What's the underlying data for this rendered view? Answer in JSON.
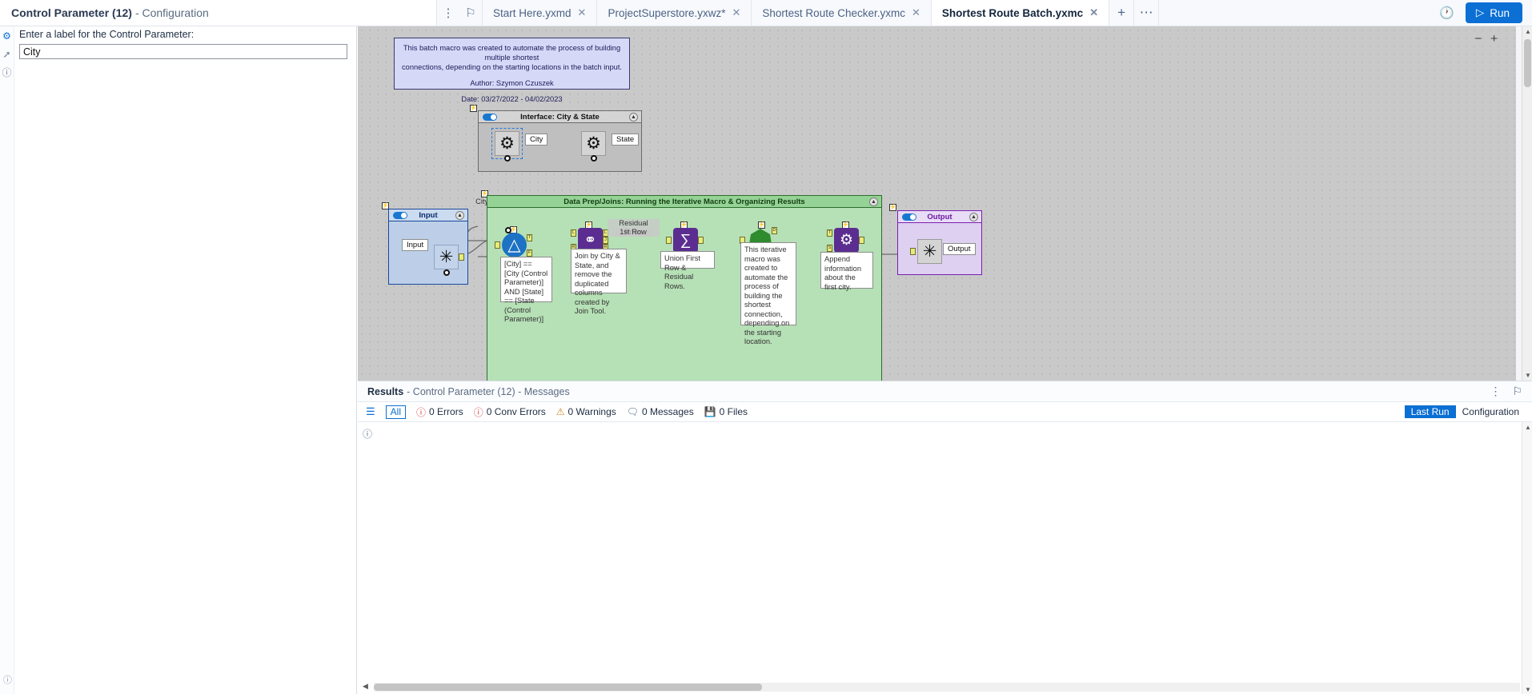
{
  "config_panel": {
    "title": "Control Parameter (12)",
    "title_sub": "- Configuration",
    "field_label": "Enter a label for the Control Parameter:",
    "field_value": "City",
    "rail_icons": [
      "gear-icon",
      "arrow-out-icon",
      "help-icon"
    ],
    "rail_bottom_icon": "help-circle-icon"
  },
  "tabs": [
    {
      "label": "Start Here.yxmd",
      "close": "✕",
      "active": false
    },
    {
      "label": "ProjectSuperstore.yxwz*",
      "close": "✕",
      "active": false
    },
    {
      "label": "Shortest Route Checker.yxmc",
      "close": "✕",
      "active": false
    },
    {
      "label": "Shortest Route Batch.yxmc",
      "close": "✕",
      "active": true
    }
  ],
  "tab_controls": {
    "add": "+",
    "more": "⋯",
    "overflow": "⋮",
    "pin": "⚐"
  },
  "toolbar_right": {
    "history_icon": "history-icon",
    "run_label": "Run",
    "run_icon": "▷"
  },
  "canvas": {
    "zoom_out": "−",
    "zoom_in": "+",
    "comment": {
      "line1": "This batch macro was created to automate the process of building multiple shortest",
      "line2": "connections, depending on the starting locations in the batch input.",
      "line3": "Author: Szymon Czuszek",
      "line4": "Date: 03/27/2022 - 04/02/2023"
    },
    "containers": [
      {
        "id": "interface",
        "title": "Interface: City & State"
      },
      {
        "id": "input",
        "title": "Input"
      },
      {
        "id": "dataprep",
        "title": "Data Prep/Joins: Running the Iterative Macro & Organizing Results"
      },
      {
        "id": "output",
        "title": "Output"
      }
    ],
    "tool_labels": {
      "city": "City",
      "state": "State",
      "input": "Input",
      "output": "Output"
    },
    "wire_labels": {
      "city_control_parameter": "City (Control Parameter)",
      "residual_rows": "Residual Rows",
      "first_row": "1st Row"
    },
    "notes": {
      "filter": "[City] == [City (Control Parameter)] AND [State] == [State (Control Parameter)]",
      "join": "Join by City & State, and remove the duplicated columns created by Join Tool.",
      "union": "Union First Row & Residual Rows.",
      "iterative": "This iterative macro was created to automate the process of building the shortest connection, depending on the starting location.",
      "append": "Append information about the first city."
    }
  },
  "results": {
    "title": "Results",
    "title_sub": "- Control Parameter (12) - Messages",
    "head_icons": {
      "more": "⋮",
      "pin": "⚐"
    },
    "filters": [
      {
        "name": "all",
        "label": "All",
        "icon": ""
      },
      {
        "name": "errors",
        "label": "0 Errors",
        "icon": "ⓘ"
      },
      {
        "name": "conv-errors",
        "label": "0 Conv Errors",
        "icon": "ⓘ"
      },
      {
        "name": "warnings",
        "label": "0 Warnings",
        "icon": "⚠"
      },
      {
        "name": "messages",
        "label": "0 Messages",
        "icon": "❐"
      },
      {
        "name": "files",
        "label": "0 Files",
        "icon": "὚b"
      }
    ],
    "segments": {
      "last_run": "Last Run",
      "configuration": "Configuration"
    },
    "list_icon": "list-icon",
    "help_icon": "help-circle-icon"
  },
  "colors": {
    "accent": "#0b6fd4",
    "comment_bg": "#d6d8f7",
    "green_container": "#b6e0b6",
    "input_container": "#bdcfe8",
    "output_container": "#ddd0f0",
    "purple_tool": "#5b2d91"
  }
}
